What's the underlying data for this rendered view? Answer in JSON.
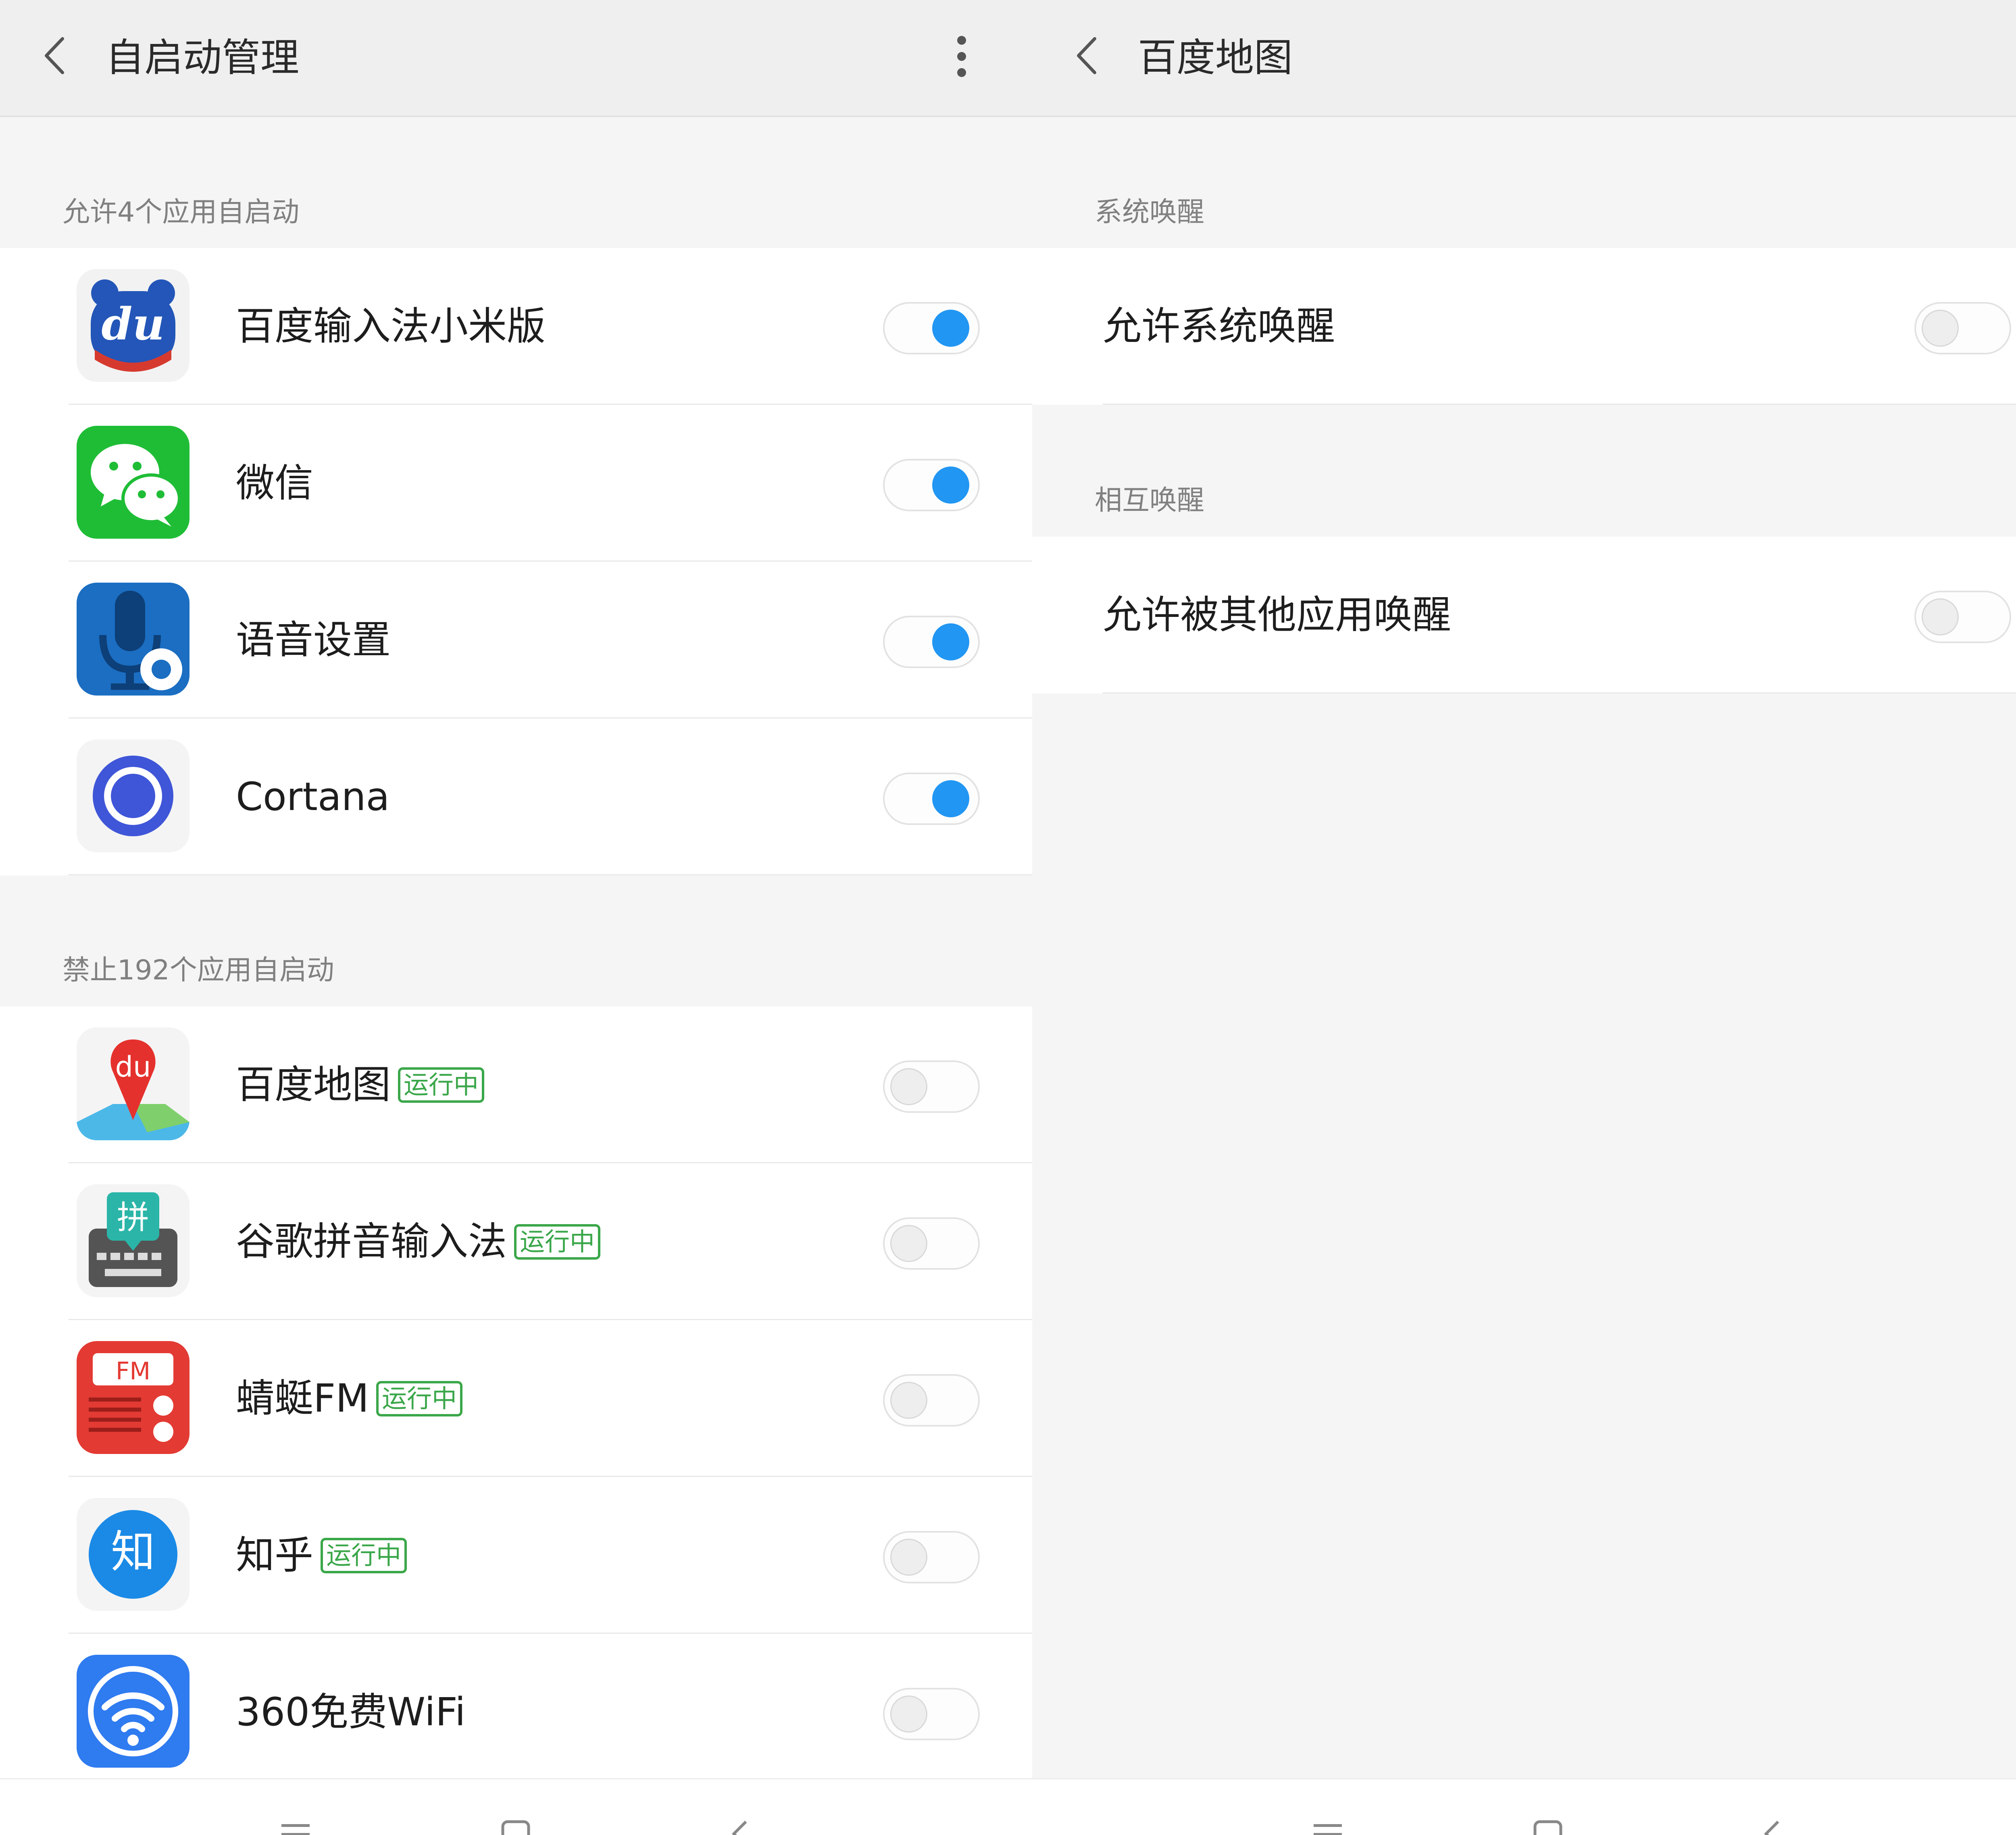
{
  "left": {
    "title": "自启动管理",
    "allowed_header": "允许4个应用自启动",
    "allowed_apps": [
      {
        "name": "百度输入法小米版",
        "icon": "baidu-input-icon",
        "enabled": true
      },
      {
        "name": "微信",
        "icon": "wechat-icon",
        "enabled": true
      },
      {
        "name": "语音设置",
        "icon": "voice-settings-icon",
        "enabled": true
      },
      {
        "name": "Cortana",
        "icon": "cortana-icon",
        "enabled": true
      }
    ],
    "blocked_header": "禁止192个应用自启动",
    "blocked_apps": [
      {
        "name": "百度地图",
        "icon": "baidu-map-icon",
        "badge": "运行中",
        "enabled": false
      },
      {
        "name": "谷歌拼音输入法",
        "icon": "google-pinyin-icon",
        "badge": "运行中",
        "enabled": false
      },
      {
        "name": "蜻蜓FM",
        "icon": "qingting-fm-icon",
        "badge": "运行中",
        "enabled": false
      },
      {
        "name": "知乎",
        "icon": "zhihu-icon",
        "badge": "运行中",
        "enabled": false
      },
      {
        "name": "360免费WiFi",
        "icon": "wifi-360-icon",
        "enabled": false
      }
    ],
    "icon_text": {
      "du": "du",
      "pin": "拼",
      "fm": "FM",
      "zhi": "知"
    }
  },
  "right": {
    "title": "百度地图",
    "system_header": "系统唤醒",
    "system_row": {
      "label": "允许系统唤醒",
      "enabled": false
    },
    "mutual_header": "相互唤醒",
    "mutual_row": {
      "label": "允许被其他应用唤醒",
      "enabled": false
    }
  },
  "colors": {
    "toggle_on": "#2196f3",
    "badge": "#3ba74a",
    "background": "#f5f5f5"
  }
}
